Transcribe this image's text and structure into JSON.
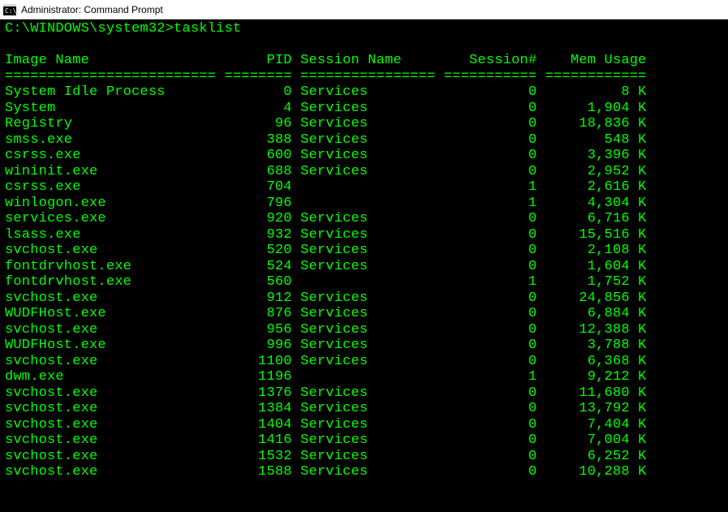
{
  "title": "Administrator: Command Prompt",
  "prompt": "C:\\WINDOWS\\system32>",
  "command": "tasklist",
  "columns": {
    "imageName": "Image Name",
    "pid": "PID",
    "sessionName": "Session Name",
    "sessionNum": "Session#",
    "memUsage": "Mem Usage"
  },
  "col_widths": {
    "imageName": 25,
    "pid": 8,
    "sessionName": 16,
    "sessionNum": 11,
    "memUsage": 12
  },
  "rows": [
    {
      "imageName": "System Idle Process",
      "pid": "0",
      "sessionName": "Services",
      "sessionNum": "0",
      "memUsage": "8 K"
    },
    {
      "imageName": "System",
      "pid": "4",
      "sessionName": "Services",
      "sessionNum": "0",
      "memUsage": "1,904 K"
    },
    {
      "imageName": "Registry",
      "pid": "96",
      "sessionName": "Services",
      "sessionNum": "0",
      "memUsage": "18,836 K"
    },
    {
      "imageName": "smss.exe",
      "pid": "388",
      "sessionName": "Services",
      "sessionNum": "0",
      "memUsage": "548 K"
    },
    {
      "imageName": "csrss.exe",
      "pid": "600",
      "sessionName": "Services",
      "sessionNum": "0",
      "memUsage": "3,396 K"
    },
    {
      "imageName": "wininit.exe",
      "pid": "688",
      "sessionName": "Services",
      "sessionNum": "0",
      "memUsage": "2,952 K"
    },
    {
      "imageName": "csrss.exe",
      "pid": "704",
      "sessionName": "",
      "sessionNum": "1",
      "memUsage": "2,616 K"
    },
    {
      "imageName": "winlogon.exe",
      "pid": "796",
      "sessionName": "",
      "sessionNum": "1",
      "memUsage": "4,304 K"
    },
    {
      "imageName": "services.exe",
      "pid": "920",
      "sessionName": "Services",
      "sessionNum": "0",
      "memUsage": "6,716 K"
    },
    {
      "imageName": "lsass.exe",
      "pid": "932",
      "sessionName": "Services",
      "sessionNum": "0",
      "memUsage": "15,516 K"
    },
    {
      "imageName": "svchost.exe",
      "pid": "520",
      "sessionName": "Services",
      "sessionNum": "0",
      "memUsage": "2,108 K"
    },
    {
      "imageName": "fontdrvhost.exe",
      "pid": "524",
      "sessionName": "Services",
      "sessionNum": "0",
      "memUsage": "1,604 K"
    },
    {
      "imageName": "fontdrvhost.exe",
      "pid": "560",
      "sessionName": "",
      "sessionNum": "1",
      "memUsage": "1,752 K"
    },
    {
      "imageName": "svchost.exe",
      "pid": "912",
      "sessionName": "Services",
      "sessionNum": "0",
      "memUsage": "24,856 K"
    },
    {
      "imageName": "WUDFHost.exe",
      "pid": "876",
      "sessionName": "Services",
      "sessionNum": "0",
      "memUsage": "6,884 K"
    },
    {
      "imageName": "svchost.exe",
      "pid": "956",
      "sessionName": "Services",
      "sessionNum": "0",
      "memUsage": "12,388 K"
    },
    {
      "imageName": "WUDFHost.exe",
      "pid": "996",
      "sessionName": "Services",
      "sessionNum": "0",
      "memUsage": "3,788 K"
    },
    {
      "imageName": "svchost.exe",
      "pid": "1100",
      "sessionName": "Services",
      "sessionNum": "0",
      "memUsage": "6,368 K"
    },
    {
      "imageName": "dwm.exe",
      "pid": "1196",
      "sessionName": "",
      "sessionNum": "1",
      "memUsage": "9,212 K"
    },
    {
      "imageName": "svchost.exe",
      "pid": "1376",
      "sessionName": "Services",
      "sessionNum": "0",
      "memUsage": "11,680 K"
    },
    {
      "imageName": "svchost.exe",
      "pid": "1384",
      "sessionName": "Services",
      "sessionNum": "0",
      "memUsage": "13,792 K"
    },
    {
      "imageName": "svchost.exe",
      "pid": "1404",
      "sessionName": "Services",
      "sessionNum": "0",
      "memUsage": "7,404 K"
    },
    {
      "imageName": "svchost.exe",
      "pid": "1416",
      "sessionName": "Services",
      "sessionNum": "0",
      "memUsage": "7,004 K"
    },
    {
      "imageName": "svchost.exe",
      "pid": "1532",
      "sessionName": "Services",
      "sessionNum": "0",
      "memUsage": "6,252 K"
    },
    {
      "imageName": "svchost.exe",
      "pid": "1588",
      "sessionName": "Services",
      "sessionNum": "0",
      "memUsage": "10,288 K"
    }
  ]
}
